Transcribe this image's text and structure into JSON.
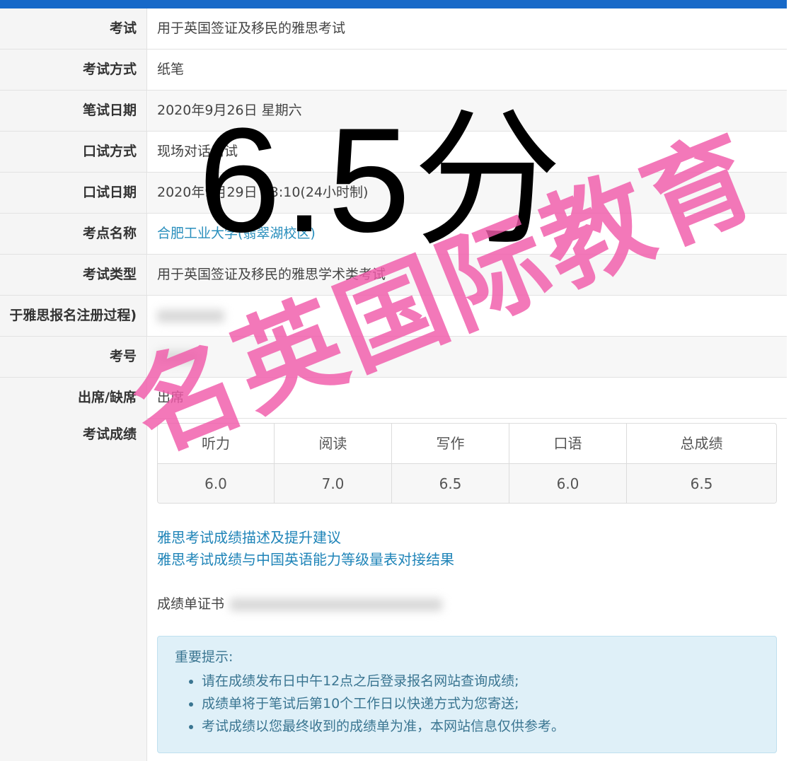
{
  "rows": [
    {
      "label": "考试",
      "value": "用于英国签证及移民的雅思考试"
    },
    {
      "label": "考试方式",
      "value": "纸笔"
    },
    {
      "label": "笔试日期",
      "value": "2020年9月26日 星期六"
    },
    {
      "label": "口试方式",
      "value": "现场对话口试"
    },
    {
      "label": "口试日期",
      "value": "2020年9月29日 13:10(24小时制)"
    },
    {
      "label": "考点名称",
      "value": "合肥工业大学(翡翠湖校区)"
    },
    {
      "label": "考试类型",
      "value": "用于英国签证及移民的雅思学术类考试"
    },
    {
      "label": "于雅思报名注册过程)",
      "value": ""
    },
    {
      "label": "考号",
      "value": ""
    },
    {
      "label": "出席/缺席",
      "value": "出席"
    }
  ],
  "scores": {
    "label": "考试成绩",
    "headers": [
      "听力",
      "阅读",
      "写作",
      "口语",
      "总成绩"
    ],
    "values": [
      "6.0",
      "7.0",
      "6.5",
      "6.0",
      "6.5"
    ]
  },
  "links": [
    "雅思考试成绩描述及提升建议",
    "雅思考试成绩与中国英语能力等级量表对接结果"
  ],
  "certificate_label": "成绩单证书",
  "notice": {
    "title": "重要提示:",
    "items": [
      "请在成绩发布日中午12点之后登录报名网站查询成绩;",
      "成绩单将于笔试后第10个工作日以快递方式为您寄送;",
      "考试成绩以您最终收到的成绩单为准，本网站信息仅供参考。"
    ]
  },
  "overlay": {
    "score_text": "6.5分",
    "watermark_text": "名英国际教育"
  }
}
